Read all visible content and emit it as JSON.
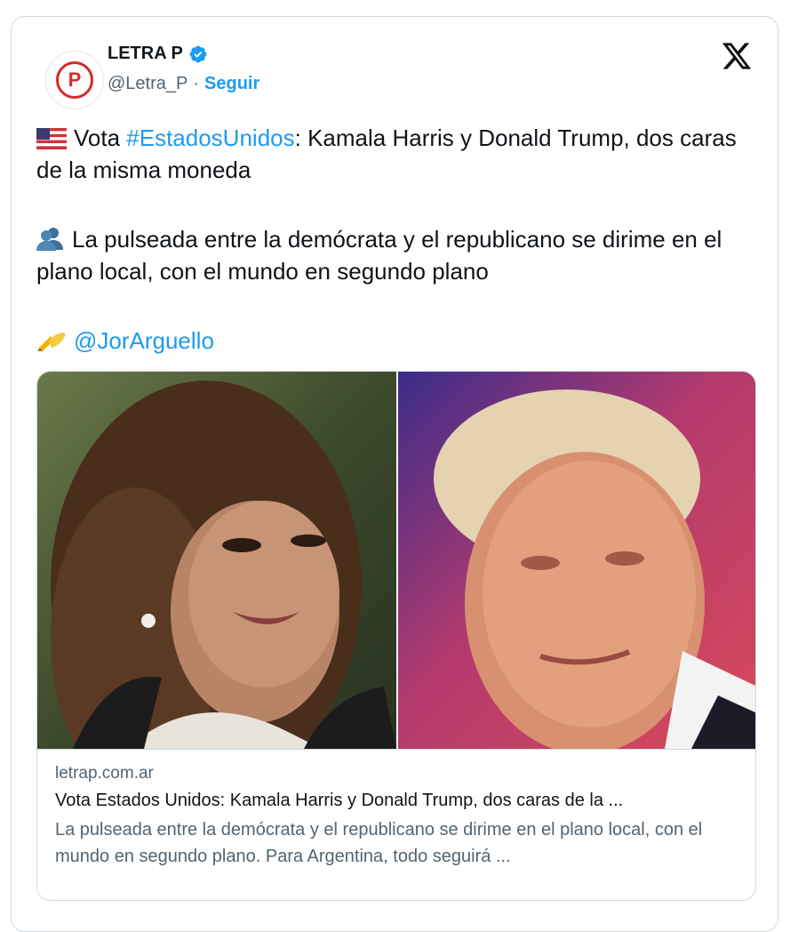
{
  "account": {
    "name": "LETRA P",
    "handle": "@Letra_P",
    "separator": "·",
    "follow_label": "Seguir",
    "avatar_letter": "P"
  },
  "tweet": {
    "p1_prefix": "Vota ",
    "p1_hashtag": "#EstadosUnidos",
    "p1_rest": ": Kamala Harris y Donald Trump, dos caras de la misma moneda",
    "p2": "La pulseada entre la demócrata y el republicano se dirime en el plano local, con el mundo en segundo plano",
    "p3_mention": "@JorArguello"
  },
  "link_card": {
    "domain": "letrap.com.ar",
    "headline": "Vota Estados Unidos: Kamala Harris y Donald Trump, dos caras de la ...",
    "description": "La pulseada entre la demócrata y el republicano se dirime en el plano local, con el mundo en segundo plano. Para Argentina, todo seguirá ..."
  },
  "colors": {
    "accent": "#1d9bf0",
    "brand_red": "#d42b2b",
    "border": "#cfd9de",
    "secondary_text": "#536471"
  },
  "icons": [
    "verified-badge-icon",
    "x-logo-icon",
    "us-flag-icon",
    "people-silhouette-icon",
    "writing-hand-icon"
  ]
}
